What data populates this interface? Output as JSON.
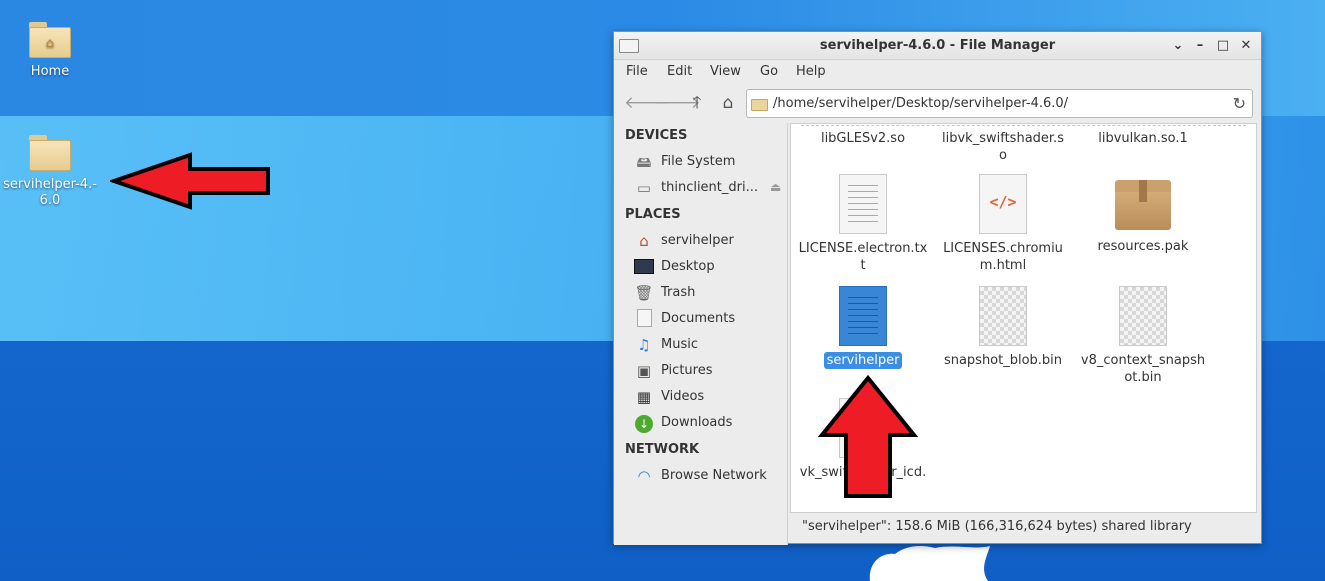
{
  "desktop": {
    "icons": [
      {
        "label": "Home"
      },
      {
        "label": "servihelper-4.-\n6.0"
      }
    ]
  },
  "window": {
    "title": "servihelper-4.6.0 - File Manager",
    "controls": {
      "menu": "⌄",
      "minimize": "–",
      "maximize": "□",
      "close": "✕"
    },
    "menu": [
      "File",
      "Edit",
      "View",
      "Go",
      "Help"
    ],
    "address": "/home/servihelper/Desktop/servihelper-4.6.0/",
    "sidebar": {
      "devices_header": "DEVICES",
      "devices": [
        {
          "label": "File System",
          "icon": "drive-icon"
        },
        {
          "label": "thinclient_dri...",
          "icon": "removable-drive-icon"
        }
      ],
      "places_header": "PLACES",
      "places": [
        {
          "label": "servihelper",
          "icon": "home-icon"
        },
        {
          "label": "Desktop",
          "icon": "desktop-icon"
        },
        {
          "label": "Trash",
          "icon": "trash-icon"
        },
        {
          "label": "Documents",
          "icon": "documents-icon"
        },
        {
          "label": "Music",
          "icon": "music-icon"
        },
        {
          "label": "Pictures",
          "icon": "pictures-icon"
        },
        {
          "label": "Videos",
          "icon": "videos-icon"
        },
        {
          "label": "Downloads",
          "icon": "downloads-icon"
        }
      ],
      "network_header": "NETWORK",
      "network": [
        {
          "label": "Browse Network",
          "icon": "network-icon"
        }
      ]
    },
    "files": [
      {
        "name": "libGLESv2.so"
      },
      {
        "name": "libvk_swiftshader.s\no"
      },
      {
        "name": "libvulkan.so.1"
      },
      {
        "name": "LICENSE.electron.tx\nt"
      },
      {
        "name": "LICENSES.chromiu\nm.html"
      },
      {
        "name": "resources.pak"
      },
      {
        "name": "servihelper",
        "selected": true
      },
      {
        "name": "snapshot_blob.bin"
      },
      {
        "name": "v8_context_snapsh\not.bin"
      },
      {
        "name": "vk_swiftshader_icd.\njson"
      }
    ],
    "status": "\"servihelper\": 158.6 MiB (166,316,624 bytes) shared library"
  }
}
